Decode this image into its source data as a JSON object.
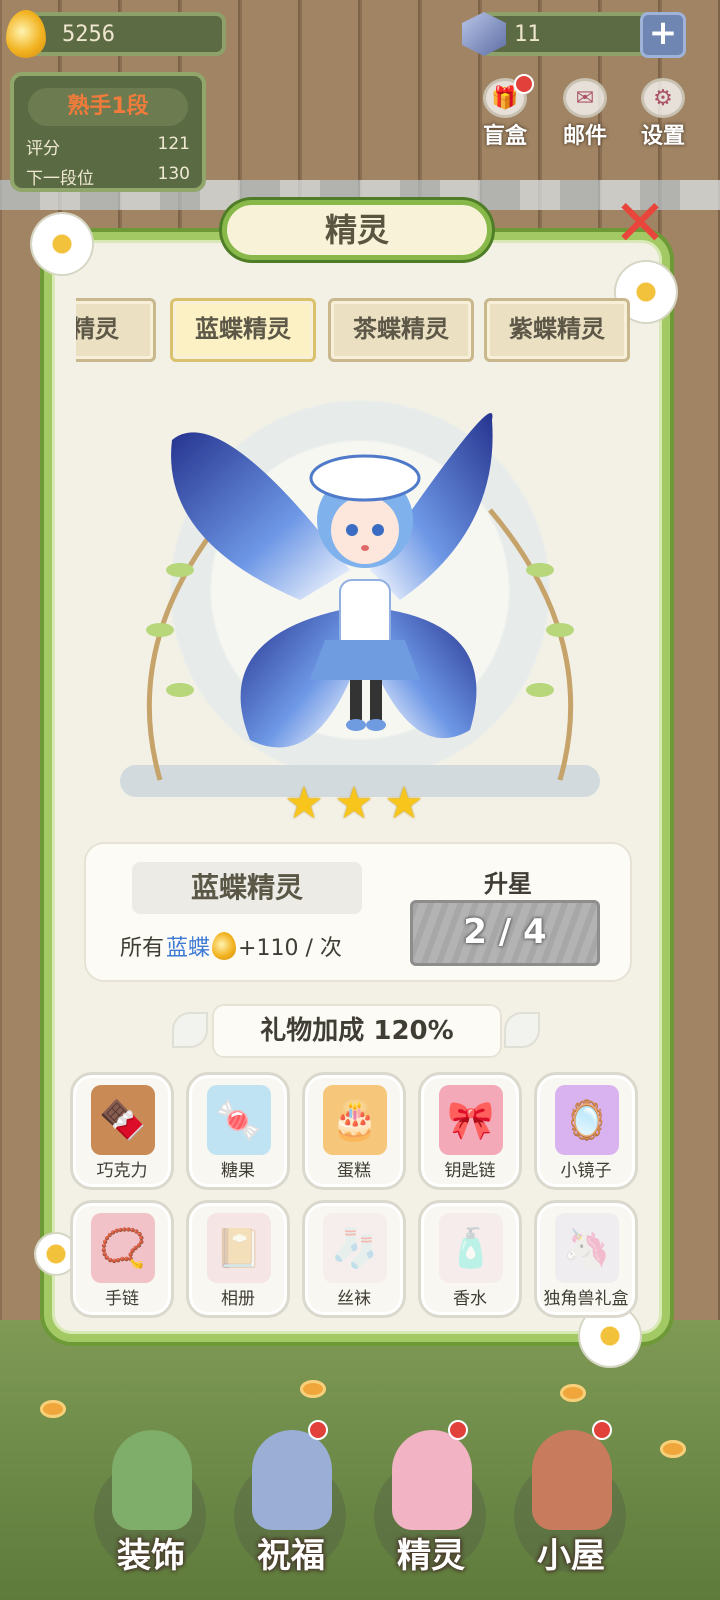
{
  "hud": {
    "coins": "5256",
    "gems": "11",
    "plus": "+"
  },
  "rank": {
    "title": "熟手1段",
    "score_label": "评分",
    "score_value": "121",
    "next_label": "下一段位",
    "next_value": "130"
  },
  "top_menu": [
    {
      "label": "盲盒",
      "icon": "gift-box-icon",
      "badge": true
    },
    {
      "label": "邮件",
      "icon": "mail-icon",
      "badge": false
    },
    {
      "label": "设置",
      "icon": "gear-icon",
      "badge": false
    }
  ],
  "panel": {
    "title": "精灵",
    "close": "✕"
  },
  "tabs": [
    {
      "label": "蝶精灵",
      "active": false
    },
    {
      "label": "蓝蝶精灵",
      "active": true
    },
    {
      "label": "茶蝶精灵",
      "active": false
    },
    {
      "label": "紫蝶精灵",
      "active": false
    }
  ],
  "character": {
    "stars": 3,
    "star_glyph": "★"
  },
  "info": {
    "name": "蓝蝶精灵",
    "bonus_prefix": "所有",
    "bonus_highlight": "蓝蝶",
    "bonus_suffix": "+110 / 次",
    "upstar_label": "升星",
    "upstar_progress": "2 / 4"
  },
  "gift_bonus": "礼物加成 120%",
  "gifts": [
    {
      "label": "巧克力",
      "icon": "chocolate-icon",
      "glyph": "🍫",
      "locked": false,
      "bg": "#c98a55"
    },
    {
      "label": "糖果",
      "icon": "candy-jar-icon",
      "glyph": "🍬",
      "locked": false,
      "bg": "#bfe3f2"
    },
    {
      "label": "蛋糕",
      "icon": "cake-icon",
      "glyph": "🎂",
      "locked": false,
      "bg": "#f6c77a"
    },
    {
      "label": "钥匙链",
      "icon": "keychain-icon",
      "glyph": "🎀",
      "locked": false,
      "bg": "#f3a9b8"
    },
    {
      "label": "小镜子",
      "icon": "mirror-icon",
      "glyph": "🪞",
      "locked": false,
      "bg": "#d9b2f0"
    },
    {
      "label": "手链",
      "icon": "bracelet-icon",
      "glyph": "📿",
      "locked": false,
      "bg": "#f2c2c9"
    },
    {
      "label": "相册",
      "icon": "photo-album-icon",
      "glyph": "📔",
      "locked": true,
      "bg": "#f0c8cf"
    },
    {
      "label": "丝袜",
      "icon": "stockings-icon",
      "glyph": "🧦",
      "locked": true,
      "bg": "#f2dfe3"
    },
    {
      "label": "香水",
      "icon": "perfume-icon",
      "glyph": "🧴",
      "locked": true,
      "bg": "#f5d9e3"
    },
    {
      "label": "独角兽礼盒",
      "icon": "unicorn-box-icon",
      "glyph": "🦄",
      "locked": true,
      "bg": "#e4ddf3"
    }
  ],
  "bottom_nav": [
    {
      "label": "装饰",
      "icon": "plant-icon",
      "badge": false,
      "color": "#7fae6a"
    },
    {
      "label": "祝福",
      "icon": "fairy-icon",
      "badge": true,
      "color": "#9aaed6"
    },
    {
      "label": "精灵",
      "icon": "sprite-icon",
      "badge": true,
      "color": "#f2b3c4"
    },
    {
      "label": "小屋",
      "icon": "house-icon",
      "badge": true,
      "color": "#c97b5e"
    }
  ],
  "colors": {
    "panel_border": "#a3c964",
    "accent_blue": "#3f7bd4",
    "star": "#f7c51c",
    "close": "#e8453c"
  }
}
